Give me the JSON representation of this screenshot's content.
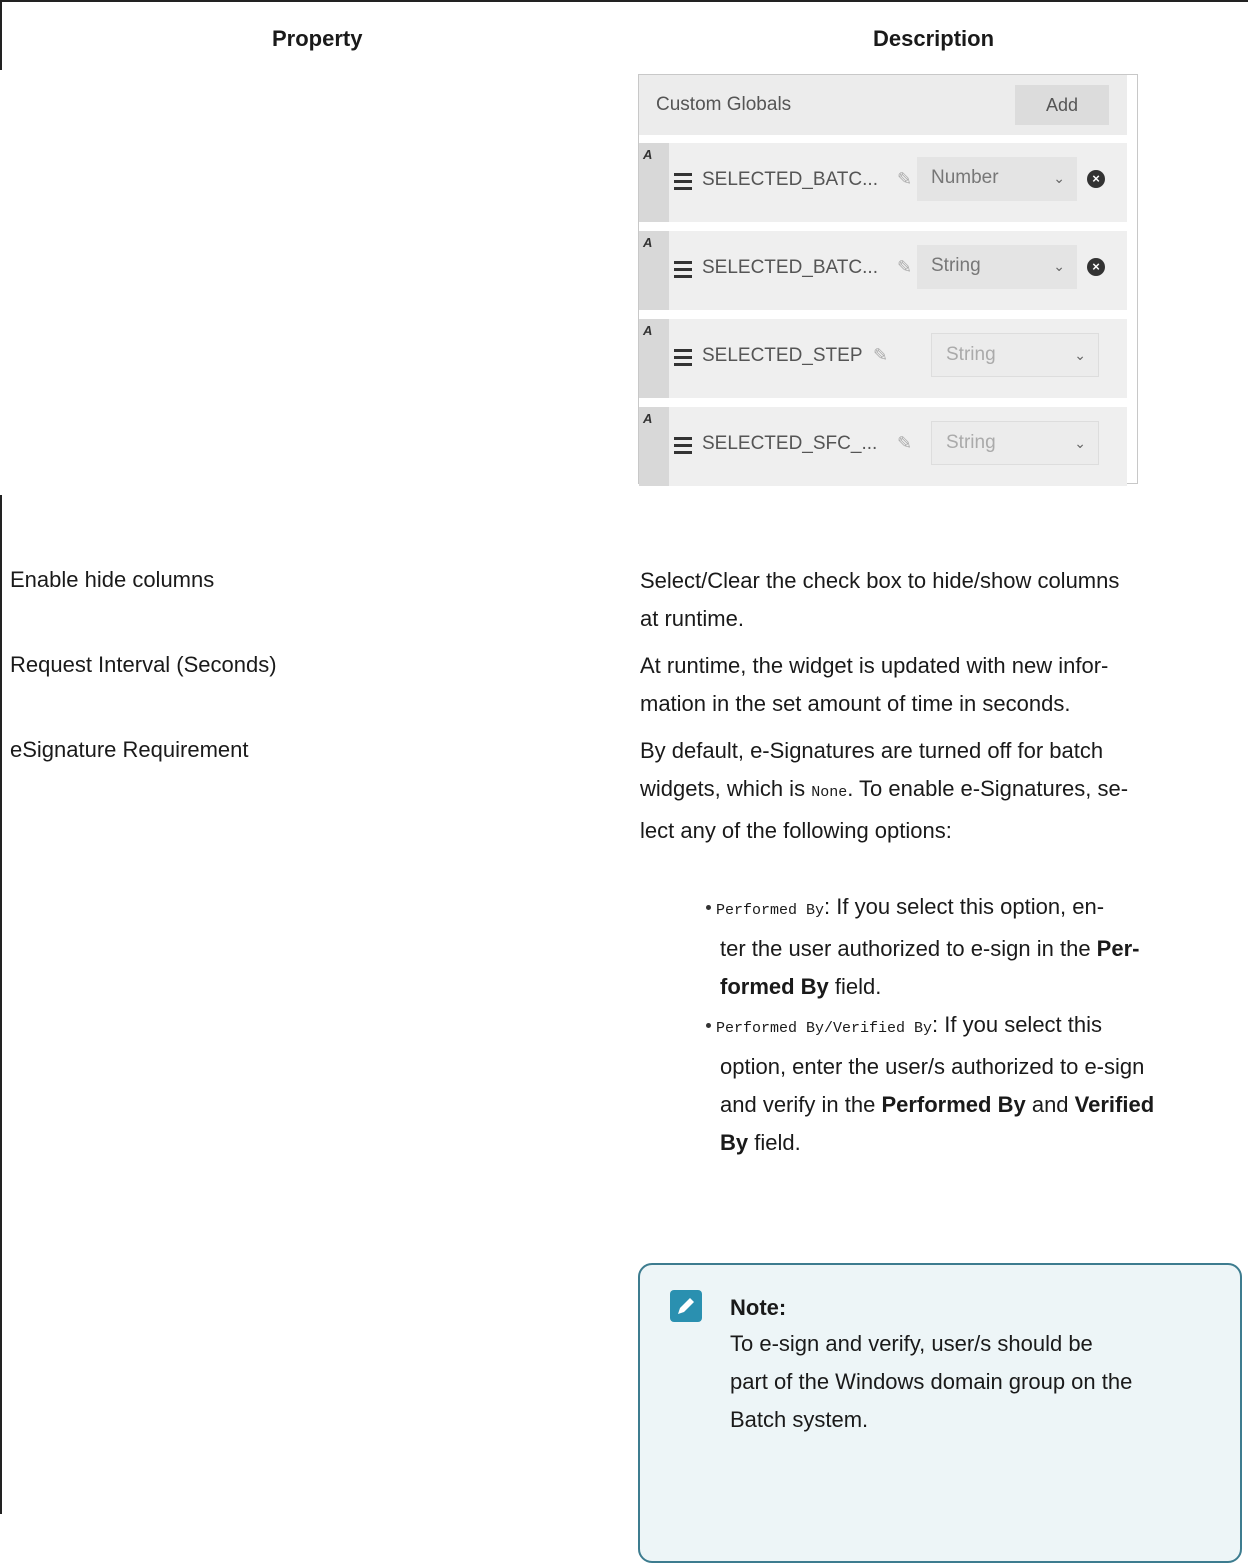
{
  "table": {
    "header_property": "Property",
    "header_description": "Description"
  },
  "screenshot": {
    "title": "Custom Globals",
    "add_label": "Add",
    "rows": [
      {
        "badge": "A",
        "name": "SELECTED_BATC...",
        "type": "Number",
        "removable": true,
        "disabled": false
      },
      {
        "badge": "A",
        "name": "SELECTED_BATC...",
        "type": "String",
        "removable": true,
        "disabled": false
      },
      {
        "badge": "A",
        "name": "SELECTED_STEP",
        "type": "String",
        "removable": false,
        "disabled": true
      },
      {
        "badge": "A",
        "name": "SELECTED_SFC_...",
        "type": "String",
        "removable": false,
        "disabled": true
      }
    ]
  },
  "rows": [
    {
      "property": "Enable hide columns",
      "description_lines": [
        "Select/Clear the check box to hide/show columns",
        "at runtime."
      ]
    },
    {
      "property": "Request Interval (Seconds)",
      "description_lines": [
        "At runtime, the widget is updated with new infor-",
        "mation in the set amount of time in seconds."
      ]
    },
    {
      "property": "eSignature Requirement",
      "description_line1": "By default, e-Signatures are turned off for batch",
      "description_line2_pre": "widgets, which is ",
      "description_line2_code": "None",
      "description_line2_post": ". To enable e-Signatures, se-",
      "description_line3": "lect any of the following options:"
    }
  ],
  "options": [
    {
      "code": "Performed By",
      "line1_rest": ": If you select this option, en-",
      "line2_pre": "ter the user authorized to e-sign in the ",
      "line2_bold": "Per-",
      "line3_bold": "formed By",
      "line3_rest": " field."
    },
    {
      "code": "Performed By/Verified By",
      "line1_rest": ": If you select this",
      "line2": "option, enter the user/s authorized to e-sign",
      "line3_pre": "and verify in the ",
      "line3_bold1": "Performed By",
      "line3_mid": " and ",
      "line3_bold2": "Verified",
      "line4_bold": "By",
      "line4_rest": " field."
    }
  ],
  "note": {
    "title": "Note:",
    "lines": [
      "To e-sign and verify, user/s should be",
      "part of the Windows domain group on the",
      "Batch system."
    ]
  }
}
